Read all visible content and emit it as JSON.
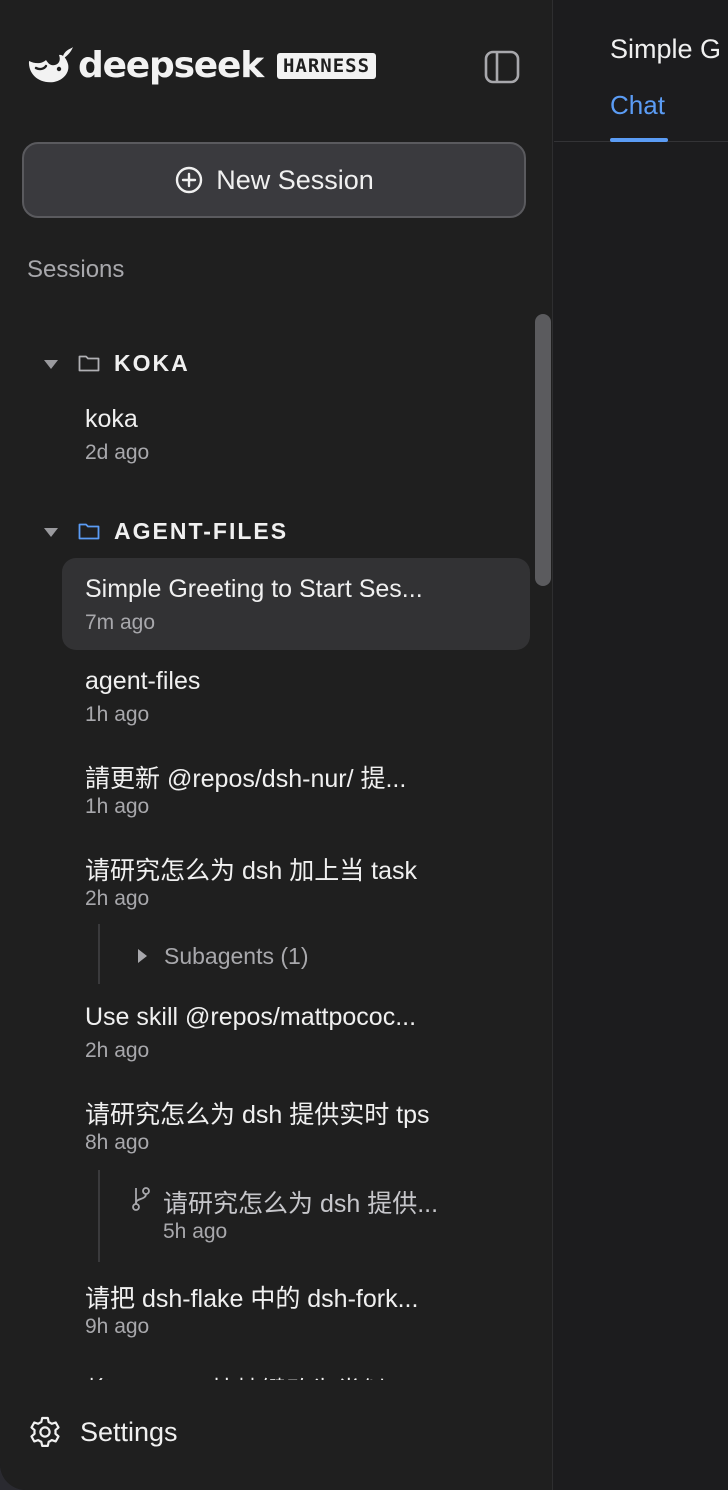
{
  "brand": {
    "name": "deepseek",
    "badge": "HARNESS"
  },
  "sidebar": {
    "new_session_label": "New Session",
    "sessions_heading": "Sessions",
    "groups": [
      {
        "name": "KOKA",
        "sessions": [
          {
            "title": "koka",
            "time": "2d ago"
          }
        ]
      },
      {
        "name": "AGENT-FILES",
        "sessions": [
          {
            "title": "Simple Greeting to Start Ses...",
            "time": "7m ago",
            "active": true
          },
          {
            "title": "agent-files",
            "time": "1h ago"
          },
          {
            "title": "請更新 @repos/dsh-nur/ 提...",
            "time": "1h ago"
          },
          {
            "title": "请研究怎么为 dsh 加上当 task",
            "time": "2h ago",
            "subagents_label": "Subagents (1)"
          },
          {
            "title": "Use skill @repos/mattpococ...",
            "time": "2h ago"
          },
          {
            "title": "请研究怎么为 dsh 提供实时 tps",
            "time": "8h ago",
            "fork": {
              "title": "请研究怎么为 dsh 提供...",
              "time": "5h ago"
            }
          },
          {
            "title": "请把 dsh-flake 中的 dsh-fork...",
            "time": "9h ago"
          },
          {
            "title": "将Windows快捷键改为类似M",
            "time": ""
          }
        ]
      }
    ],
    "settings_label": "Settings"
  },
  "main": {
    "title": "Simple G",
    "tab_chat": "Chat"
  },
  "colors": {
    "accent": "#5b9cf5",
    "sidebar_bg": "#1f1f1f",
    "main_bg": "#1c1c1e"
  }
}
